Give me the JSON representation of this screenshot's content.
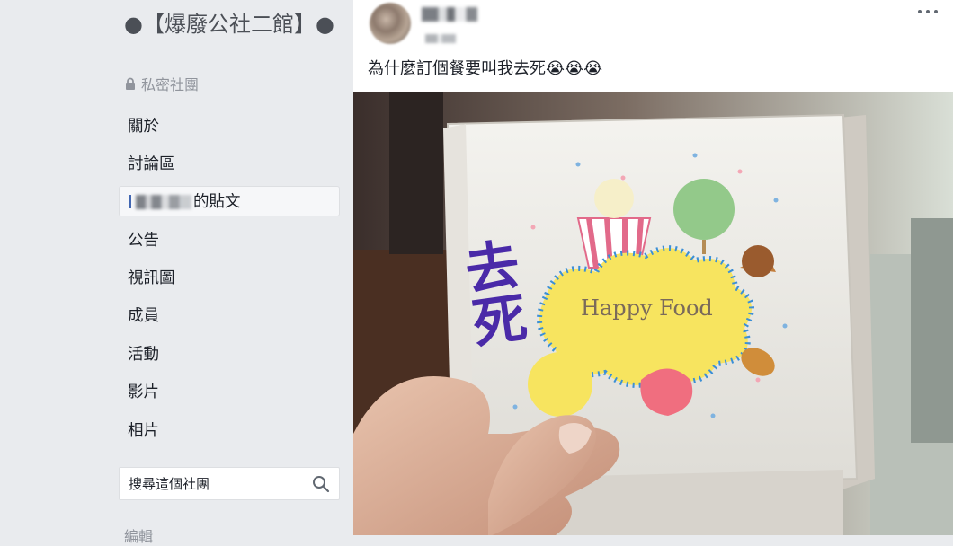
{
  "group": {
    "title": "●【爆廢公社二館】●",
    "privacy": "私密社團"
  },
  "sidebar": {
    "items": [
      {
        "label": "關於"
      },
      {
        "label": "討論區"
      },
      {
        "label": "的貼文",
        "active": true
      },
      {
        "label": "公告"
      },
      {
        "label": "視訊圖"
      },
      {
        "label": "成員"
      },
      {
        "label": "活動"
      },
      {
        "label": "影片"
      },
      {
        "label": "相片"
      }
    ],
    "search": {
      "placeholder": "搜尋這個社團"
    },
    "cut_label": "編輯"
  },
  "post": {
    "text": "為什麼訂個餐要叫我去死😭😭😭",
    "photo": {
      "handwriting": "去死",
      "logo_text": "Happy Food"
    }
  },
  "colors": {
    "page_bg": "#e9ebee",
    "accent": "#4267b2",
    "muted": "#90949c",
    "box_yellow": "#f7e45f",
    "box_blue": "#3b8fd6",
    "ink_purple": "#4a2aa8"
  },
  "icons": [
    "lock-icon",
    "search-icon",
    "more-icon"
  ]
}
